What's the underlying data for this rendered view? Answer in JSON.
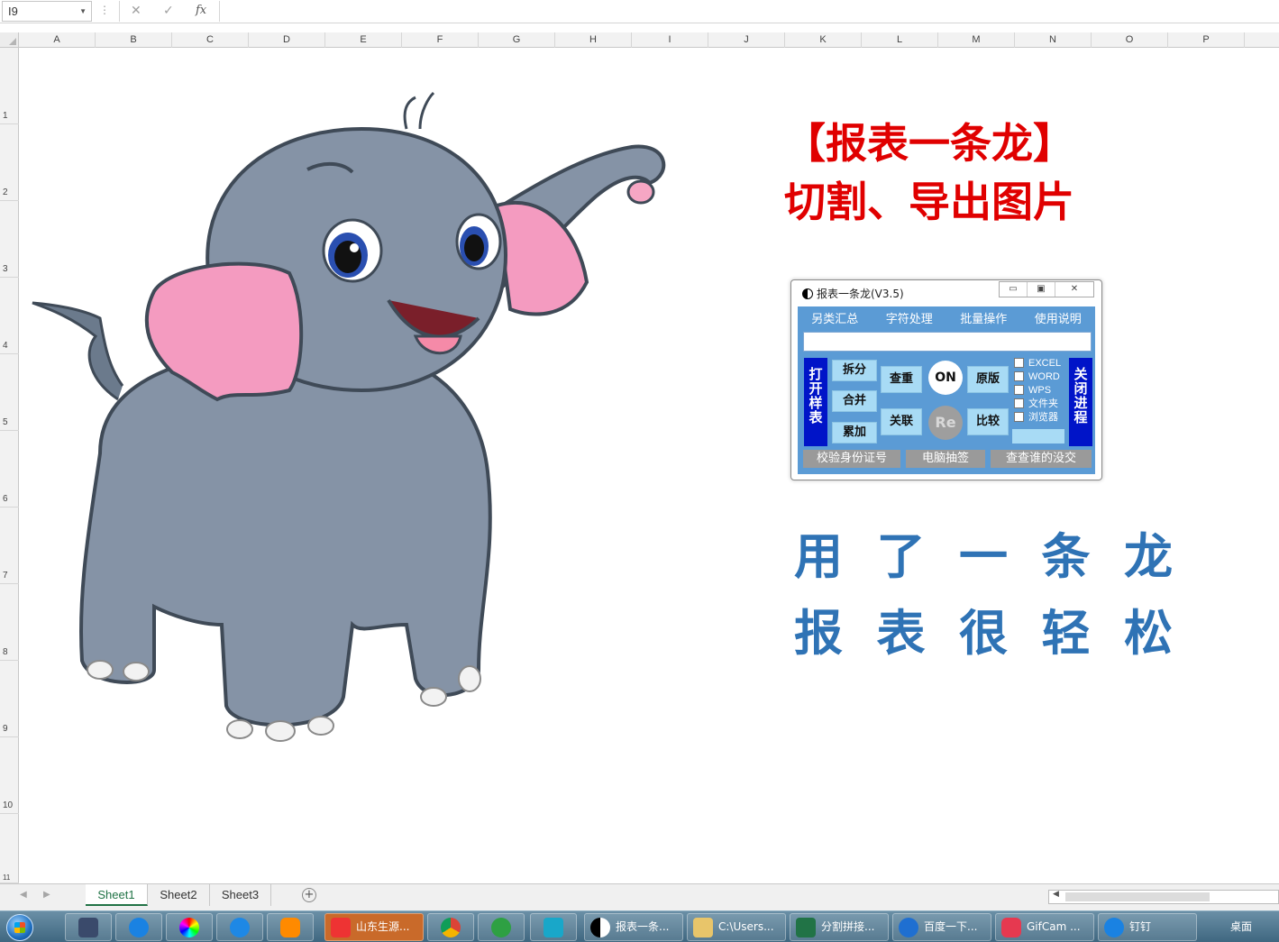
{
  "formula_bar": {
    "name_box": "I9",
    "cancel_glyph": "✕",
    "enter_glyph": "✓",
    "fx_label": "fx",
    "formula": ""
  },
  "columns": [
    "A",
    "B",
    "C",
    "D",
    "E",
    "F",
    "G",
    "H",
    "I",
    "J",
    "K",
    "L",
    "M",
    "N",
    "O",
    "P"
  ],
  "rows": [
    "1",
    "2",
    "3",
    "4",
    "5",
    "6",
    "7",
    "8",
    "9",
    "10",
    "11"
  ],
  "title": {
    "line1": "【报表一条龙】",
    "line2": "切割、导出图片"
  },
  "slogan": {
    "row1": [
      "用",
      "了",
      "一",
      "条",
      "龙"
    ],
    "row2": [
      "报",
      "表",
      "很",
      "轻",
      "松"
    ]
  },
  "dialog": {
    "title": "报表一条龙(V3.5)",
    "controls": {
      "minimize": "▭",
      "restore": "▣",
      "close": "✕"
    },
    "menu": [
      "另类汇总",
      "字符处理",
      "批量操作",
      "使用说明"
    ],
    "input_value": "",
    "open_sample": "打开样表",
    "close_process": "关闭进程",
    "split": "拆分",
    "merge": "合并",
    "accumulate": "累加",
    "dedupe": "查重",
    "link": "关联",
    "on": "ON",
    "re": "Re",
    "original": "原版",
    "compare": "比较",
    "checkboxes": [
      "EXCEL",
      "WORD",
      "WPS",
      "文件夹",
      "浏览器"
    ],
    "bottom_buttons": [
      "校验身份证号",
      "电脑抽签",
      "查查谁的没交"
    ]
  },
  "sheet_tabs": [
    "Sheet1",
    "Sheet2",
    "Sheet3"
  ],
  "active_sheet": "Sheet1",
  "taskbar": {
    "items": [
      "山东生源...",
      "报表一条...",
      "C:\\Users...",
      "分割拼接...",
      "百度一下...",
      "GifCam ...",
      "钉钉"
    ],
    "desktop": "桌面"
  },
  "colors": {
    "title_red": "#e00000",
    "slogan_blue": "#2f73b5",
    "dialog_blue": "#5b9bd5",
    "button_navy": "#0014c8",
    "button_light": "#a8dbf5",
    "excel_green": "#217346"
  }
}
